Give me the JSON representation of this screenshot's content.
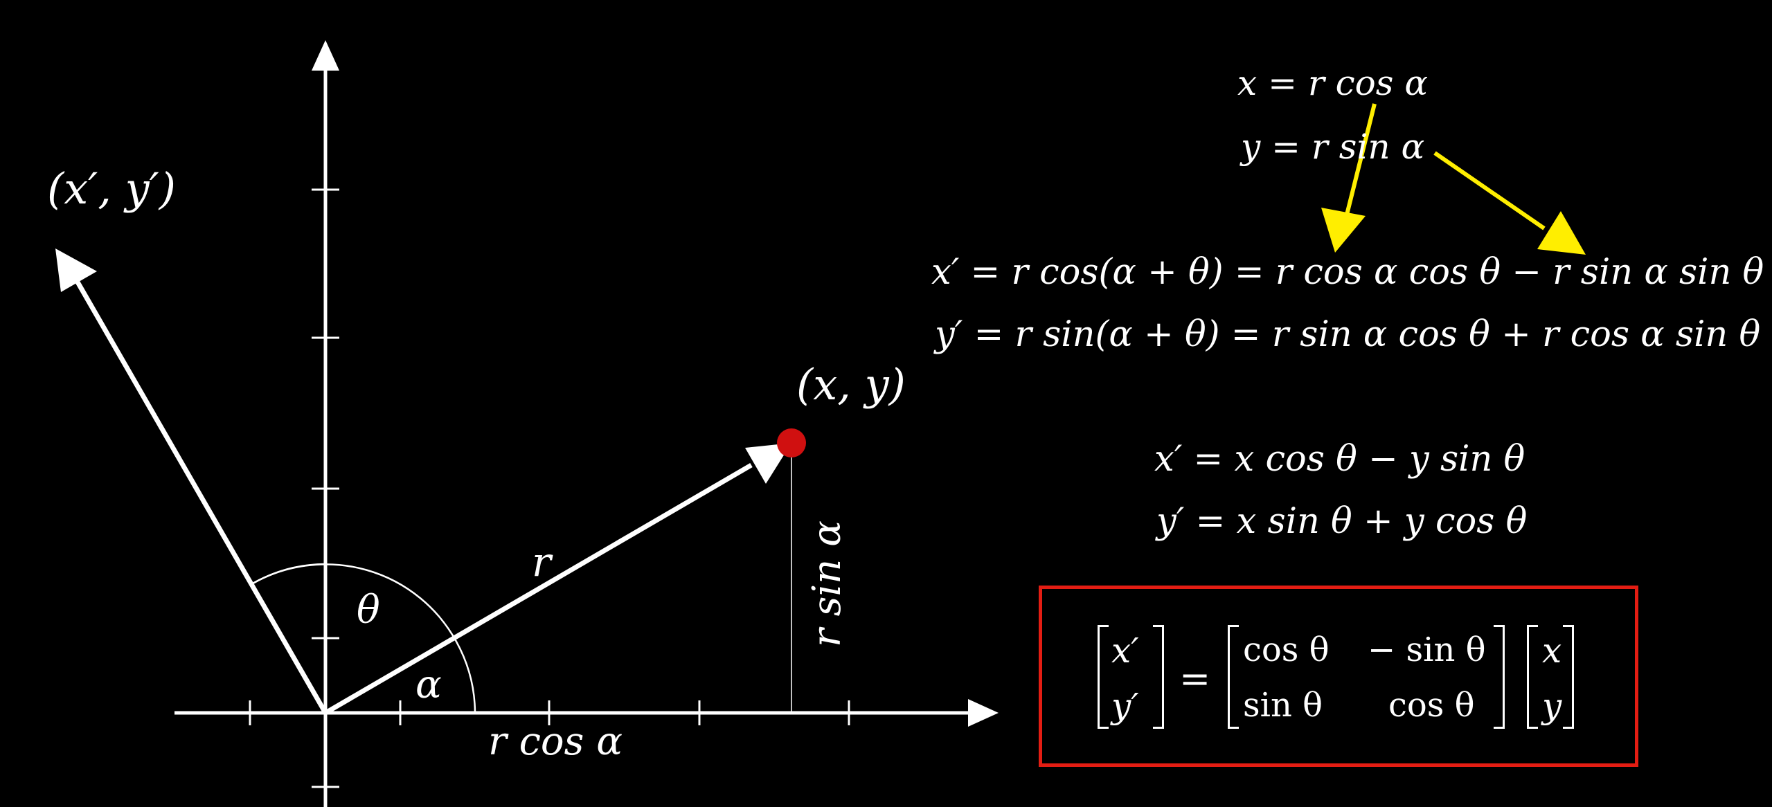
{
  "diagram": {
    "point_label": "(x, y)",
    "rotated_point_label": "(x′, y′)",
    "r_label": "r",
    "theta_label": "θ",
    "alpha_label": "α",
    "r_cos_alpha_label": "r cos α",
    "r_sin_alpha_label": "r sin α",
    "point_color": "#d01010",
    "highlight_color": "#ffee00"
  },
  "equations": {
    "x_def": "x = r cos α",
    "y_def": "y = r sin α",
    "x_prime_expand": "x′ = r cos(α + θ) = r cos α cos θ − r sin α sin θ",
    "y_prime_expand": "y′ = r sin(α + θ) = r sin α cos θ + r cos α sin θ",
    "x_prime_simple": "x′ = x cos θ − y sin θ",
    "y_prime_simple": "y′ = x sin θ + y cos θ"
  },
  "matrix_equation": {
    "box_color": "#e31d13",
    "lhs": [
      "x′",
      "y′"
    ],
    "equals": "=",
    "rotation": [
      [
        "cos θ",
        "− sin θ"
      ],
      [
        "sin θ",
        "cos θ"
      ]
    ],
    "rhs": [
      "x",
      "y"
    ]
  }
}
